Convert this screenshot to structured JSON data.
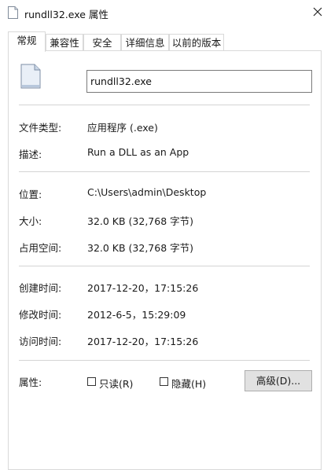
{
  "window": {
    "title": "rundll32.exe 属性",
    "close_icon": "close-icon"
  },
  "tabs": [
    {
      "label": "常规",
      "active": true
    },
    {
      "label": "兼容性"
    },
    {
      "label": "安全"
    },
    {
      "label": "详细信息"
    },
    {
      "label": "以前的版本"
    }
  ],
  "general": {
    "file_name": "rundll32.exe",
    "file_icon": "file-icon",
    "type_label": "文件类型:",
    "type_value": "应用程序 (.exe)",
    "desc_label": "描述:",
    "desc_value": "Run a DLL as an App",
    "location_label": "位置:",
    "location_value": "C:\\Users\\admin\\Desktop",
    "size_label": "大小:",
    "size_value": "32.0 KB (32,768 字节)",
    "disk_label": "占用空间:",
    "disk_value": "32.0 KB (32,768 字节)",
    "created_label": "创建时间:",
    "created_value": "2017-12-20，17:15:26",
    "modified_label": "修改时间:",
    "modified_value": "2012-6-5，15:29:09",
    "accessed_label": "访问时间:",
    "accessed_value": "2017-12-20，17:15:26",
    "attr_label": "属性:",
    "readonly_label": "只读(R)",
    "hidden_label": "隐藏(H)",
    "advanced_label": "高级(D)..."
  }
}
